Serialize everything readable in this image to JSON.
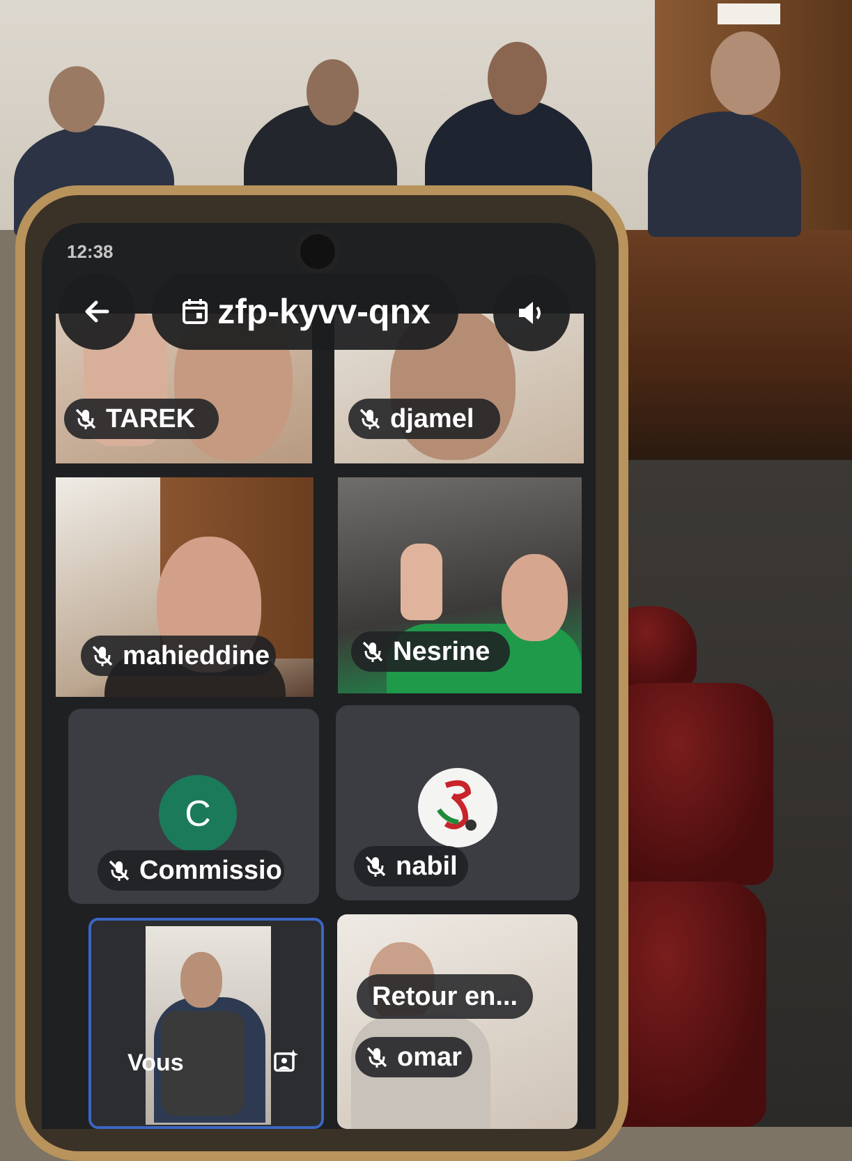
{
  "status_bar": {
    "time": "12:38"
  },
  "meeting": {
    "code": "zfp-kyvv-qnx"
  },
  "participants": [
    {
      "name": "TAREK",
      "muted": true
    },
    {
      "name": "djamel",
      "muted": true
    },
    {
      "name": "mahieddine",
      "muted": true
    },
    {
      "name": "Nesrine",
      "muted": true
    },
    {
      "name": "Commissio",
      "muted": true,
      "avatar_letter": "C"
    },
    {
      "name": "nabil",
      "muted": true
    },
    {
      "name": "omar",
      "muted": true
    }
  ],
  "self_tile": {
    "label": "Vous"
  },
  "toast": {
    "text": "Retour en..."
  },
  "colors": {
    "accent_border": "#3b66c4",
    "avatar_bg": "#1a7a5a"
  },
  "icons": [
    "back-arrow-icon",
    "calendar-icon",
    "speaker-icon",
    "mic-off-icon",
    "effects-icon"
  ]
}
